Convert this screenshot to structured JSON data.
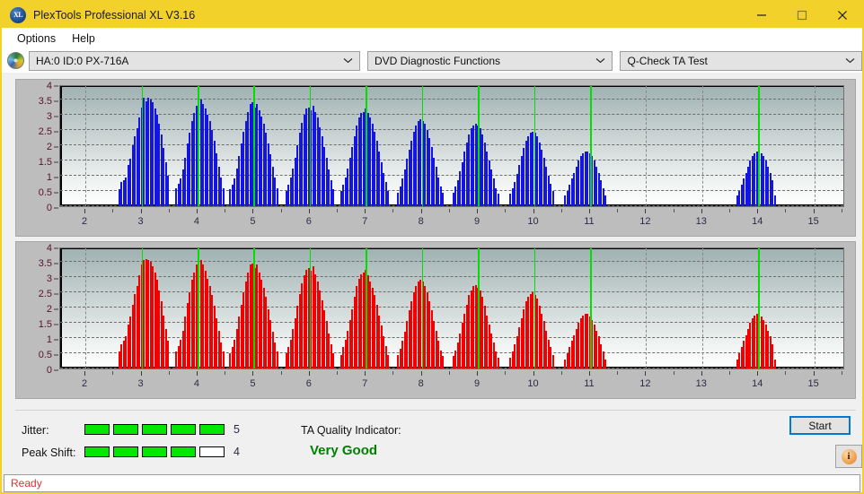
{
  "window": {
    "title": "PlexTools Professional XL V3.16",
    "icon": "XL",
    "minimize": "minimize-icon",
    "maximize": "maximize-icon",
    "close": "close-icon",
    "titlebar_color": "#f2d22a"
  },
  "menu": {
    "items": [
      {
        "label": "Options"
      },
      {
        "label": "Help"
      }
    ]
  },
  "toolbar": {
    "drive": {
      "value": "HA:0 ID:0  PX-716A"
    },
    "function": {
      "value": "DVD Diagnostic Functions"
    },
    "test": {
      "value": "Q-Check TA Test"
    }
  },
  "chart_data": [
    {
      "type": "bar",
      "title": "",
      "name": "jitter-chart",
      "series_color": "#1515e0",
      "xlabel": "",
      "ylabel": "",
      "xlim": [
        1.55,
        15.55
      ],
      "ylim": [
        0,
        4
      ],
      "xticks": [
        2,
        3,
        4,
        5,
        6,
        7,
        8,
        9,
        10,
        11,
        12,
        13,
        14,
        15
      ],
      "yticks": [
        0,
        0.5,
        1,
        1.5,
        2,
        2.5,
        3,
        3.5,
        4
      ],
      "ytick_labels": [
        "0",
        "0.5",
        "1",
        "1.5",
        "2",
        "2.5",
        "3",
        "3.5",
        "4"
      ],
      "grid": true,
      "markers_x": [
        3,
        4,
        5,
        6,
        7,
        8,
        9,
        10,
        11,
        14
      ],
      "marker_color": "#00e000",
      "x": [
        2.6,
        2.64,
        2.68,
        2.72,
        2.76,
        2.8,
        2.84,
        2.88,
        2.92,
        2.96,
        3.0,
        3.04,
        3.08,
        3.12,
        3.16,
        3.2,
        3.24,
        3.28,
        3.32,
        3.36,
        3.4,
        3.44,
        3.48,
        3.62,
        3.66,
        3.7,
        3.74,
        3.78,
        3.82,
        3.86,
        3.9,
        3.94,
        3.98,
        4.02,
        4.06,
        4.1,
        4.14,
        4.18,
        4.22,
        4.26,
        4.3,
        4.34,
        4.38,
        4.42,
        4.46,
        4.58,
        4.62,
        4.66,
        4.7,
        4.74,
        4.78,
        4.82,
        4.86,
        4.9,
        4.94,
        4.98,
        5.02,
        5.06,
        5.1,
        5.14,
        5.18,
        5.22,
        5.26,
        5.3,
        5.34,
        5.38,
        5.42,
        5.58,
        5.62,
        5.66,
        5.7,
        5.74,
        5.78,
        5.82,
        5.86,
        5.9,
        5.94,
        5.98,
        6.02,
        6.06,
        6.1,
        6.14,
        6.18,
        6.22,
        6.26,
        6.3,
        6.34,
        6.38,
        6.42,
        6.56,
        6.6,
        6.64,
        6.68,
        6.72,
        6.76,
        6.8,
        6.84,
        6.88,
        6.92,
        6.96,
        7.0,
        7.04,
        7.08,
        7.12,
        7.16,
        7.2,
        7.24,
        7.28,
        7.32,
        7.36,
        7.4,
        7.58,
        7.62,
        7.66,
        7.7,
        7.74,
        7.78,
        7.82,
        7.86,
        7.9,
        7.94,
        7.98,
        8.02,
        8.06,
        8.1,
        8.14,
        8.18,
        8.22,
        8.26,
        8.3,
        8.34,
        8.38,
        8.56,
        8.6,
        8.64,
        8.68,
        8.72,
        8.76,
        8.8,
        8.84,
        8.88,
        8.92,
        8.96,
        9.0,
        9.04,
        9.08,
        9.12,
        9.16,
        9.2,
        9.24,
        9.28,
        9.32,
        9.36,
        9.58,
        9.62,
        9.66,
        9.7,
        9.74,
        9.78,
        9.82,
        9.86,
        9.9,
        9.94,
        9.98,
        10.02,
        10.06,
        10.1,
        10.14,
        10.18,
        10.22,
        10.26,
        10.3,
        10.34,
        10.56,
        10.6,
        10.64,
        10.68,
        10.72,
        10.76,
        10.8,
        10.84,
        10.88,
        10.92,
        10.96,
        11.0,
        11.04,
        11.08,
        11.12,
        11.16,
        11.2,
        11.24,
        11.28,
        13.62,
        13.66,
        13.7,
        13.74,
        13.78,
        13.82,
        13.86,
        13.9,
        13.94,
        13.98,
        14.02,
        14.06,
        14.1,
        14.14,
        14.18,
        14.22,
        14.26,
        14.3
      ],
      "values": [
        0.55,
        0.8,
        0.85,
        0.95,
        1.35,
        1.55,
        2.0,
        2.3,
        2.55,
        2.9,
        3.25,
        3.55,
        3.45,
        3.55,
        3.5,
        3.4,
        3.2,
        3.0,
        2.7,
        2.35,
        1.9,
        1.45,
        1.0,
        0.6,
        0.75,
        0.9,
        1.2,
        1.6,
        2.05,
        2.4,
        2.8,
        3.05,
        3.3,
        3.55,
        3.5,
        3.35,
        3.2,
        3.0,
        2.8,
        2.5,
        2.15,
        1.75,
        1.3,
        0.95,
        0.6,
        0.55,
        0.7,
        0.9,
        1.25,
        1.65,
        2.05,
        2.45,
        2.8,
        3.1,
        3.35,
        3.4,
        3.25,
        3.35,
        3.15,
        2.95,
        2.7,
        2.4,
        2.05,
        1.7,
        1.3,
        0.95,
        0.6,
        0.5,
        0.7,
        0.95,
        1.25,
        1.6,
        2.0,
        2.4,
        2.75,
        3.0,
        3.2,
        3.25,
        3.15,
        3.3,
        3.1,
        2.9,
        2.6,
        2.3,
        1.95,
        1.6,
        1.2,
        0.85,
        0.55,
        0.5,
        0.7,
        0.95,
        1.25,
        1.6,
        1.95,
        2.3,
        2.65,
        2.9,
        3.05,
        3.1,
        3.2,
        3.05,
        2.9,
        2.7,
        2.45,
        2.15,
        1.8,
        1.45,
        1.1,
        0.8,
        0.5,
        0.45,
        0.65,
        0.9,
        1.2,
        1.55,
        1.85,
        2.15,
        2.45,
        2.65,
        2.8,
        2.85,
        2.8,
        2.7,
        2.5,
        2.25,
        1.95,
        1.6,
        1.3,
        0.95,
        0.65,
        0.45,
        0.45,
        0.65,
        0.85,
        1.15,
        1.45,
        1.8,
        2.1,
        2.35,
        2.55,
        2.65,
        2.7,
        2.65,
        2.55,
        2.35,
        2.1,
        1.8,
        1.5,
        1.2,
        0.9,
        0.6,
        0.4,
        0.4,
        0.6,
        0.8,
        1.05,
        1.35,
        1.65,
        1.9,
        2.15,
        2.3,
        2.4,
        2.45,
        2.4,
        2.3,
        2.1,
        1.85,
        1.6,
        1.3,
        1.0,
        0.75,
        0.5,
        0.35,
        0.5,
        0.7,
        0.9,
        1.1,
        1.3,
        1.5,
        1.65,
        1.75,
        1.8,
        1.8,
        1.75,
        1.65,
        1.5,
        1.3,
        1.1,
        0.85,
        0.6,
        0.35,
        0.35,
        0.5,
        0.7,
        0.9,
        1.1,
        1.3,
        1.5,
        1.65,
        1.75,
        1.8,
        1.8,
        1.75,
        1.65,
        1.5,
        1.3,
        1.1,
        0.85,
        0.35
      ]
    },
    {
      "type": "bar",
      "title": "",
      "name": "peak-shift-chart",
      "series_color": "#f00000",
      "xlabel": "",
      "ylabel": "",
      "xlim": [
        1.55,
        15.55
      ],
      "ylim": [
        0,
        4
      ],
      "xticks": [
        2,
        3,
        4,
        5,
        6,
        7,
        8,
        9,
        10,
        11,
        12,
        13,
        14,
        15
      ],
      "yticks": [
        0,
        0.5,
        1,
        1.5,
        2,
        2.5,
        3,
        3.5,
        4
      ],
      "ytick_labels": [
        "0",
        "0.5",
        "1",
        "1.5",
        "2",
        "2.5",
        "3",
        "3.5",
        "4"
      ],
      "grid": true,
      "markers_x": [
        3,
        4,
        5,
        6,
        7,
        8,
        9,
        10,
        11,
        14
      ],
      "marker_color": "#00e000",
      "x": [
        2.6,
        2.64,
        2.68,
        2.72,
        2.76,
        2.8,
        2.84,
        2.88,
        2.92,
        2.96,
        3.0,
        3.04,
        3.08,
        3.12,
        3.16,
        3.2,
        3.24,
        3.28,
        3.32,
        3.36,
        3.4,
        3.44,
        3.48,
        3.62,
        3.66,
        3.7,
        3.74,
        3.78,
        3.82,
        3.86,
        3.9,
        3.94,
        3.98,
        4.02,
        4.06,
        4.1,
        4.14,
        4.18,
        4.22,
        4.26,
        4.3,
        4.34,
        4.38,
        4.42,
        4.46,
        4.58,
        4.62,
        4.66,
        4.7,
        4.74,
        4.78,
        4.82,
        4.86,
        4.9,
        4.94,
        4.98,
        5.02,
        5.06,
        5.1,
        5.14,
        5.18,
        5.22,
        5.26,
        5.3,
        5.34,
        5.38,
        5.42,
        5.58,
        5.62,
        5.66,
        5.7,
        5.74,
        5.78,
        5.82,
        5.86,
        5.9,
        5.94,
        5.98,
        6.02,
        6.06,
        6.1,
        6.14,
        6.18,
        6.22,
        6.26,
        6.3,
        6.34,
        6.38,
        6.42,
        6.56,
        6.6,
        6.64,
        6.68,
        6.72,
        6.76,
        6.8,
        6.84,
        6.88,
        6.92,
        6.96,
        7.0,
        7.04,
        7.08,
        7.12,
        7.16,
        7.2,
        7.24,
        7.28,
        7.32,
        7.36,
        7.4,
        7.58,
        7.62,
        7.66,
        7.7,
        7.74,
        7.78,
        7.82,
        7.86,
        7.9,
        7.94,
        7.98,
        8.02,
        8.06,
        8.1,
        8.14,
        8.18,
        8.22,
        8.26,
        8.3,
        8.34,
        8.38,
        8.56,
        8.6,
        8.64,
        8.68,
        8.72,
        8.76,
        8.8,
        8.84,
        8.88,
        8.92,
        8.96,
        9.0,
        9.04,
        9.08,
        9.12,
        9.16,
        9.2,
        9.24,
        9.28,
        9.32,
        9.36,
        9.58,
        9.62,
        9.66,
        9.7,
        9.74,
        9.78,
        9.82,
        9.86,
        9.9,
        9.94,
        9.98,
        10.02,
        10.06,
        10.1,
        10.14,
        10.18,
        10.22,
        10.26,
        10.3,
        10.34,
        10.56,
        10.6,
        10.64,
        10.68,
        10.72,
        10.76,
        10.8,
        10.84,
        10.88,
        10.92,
        10.96,
        11.0,
        11.04,
        11.08,
        11.12,
        11.16,
        11.2,
        11.24,
        11.28,
        13.62,
        13.66,
        13.7,
        13.74,
        13.78,
        13.82,
        13.86,
        13.9,
        13.94,
        13.98,
        14.02,
        14.06,
        14.1,
        14.14,
        14.18,
        14.22,
        14.26,
        14.3
      ],
      "values": [
        0.55,
        0.8,
        0.9,
        1.05,
        1.45,
        1.7,
        2.1,
        2.45,
        2.7,
        3.05,
        3.4,
        3.55,
        3.6,
        3.55,
        3.5,
        3.35,
        3.15,
        2.9,
        2.55,
        2.2,
        1.75,
        1.3,
        0.9,
        0.55,
        0.75,
        0.95,
        1.25,
        1.7,
        2.15,
        2.5,
        2.9,
        3.15,
        3.4,
        3.6,
        3.55,
        3.4,
        3.2,
        2.95,
        2.7,
        2.4,
        2.05,
        1.65,
        1.25,
        0.85,
        0.55,
        0.5,
        0.7,
        0.95,
        1.3,
        1.7,
        2.1,
        2.5,
        2.85,
        3.15,
        3.4,
        3.45,
        3.3,
        3.4,
        3.15,
        2.9,
        2.65,
        2.35,
        1.95,
        1.6,
        1.2,
        0.85,
        0.55,
        0.5,
        0.7,
        0.95,
        1.3,
        1.65,
        2.05,
        2.45,
        2.8,
        3.05,
        3.25,
        3.3,
        3.2,
        3.35,
        3.1,
        2.85,
        2.55,
        2.25,
        1.9,
        1.55,
        1.15,
        0.8,
        0.5,
        0.45,
        0.7,
        0.95,
        1.25,
        1.6,
        1.95,
        2.35,
        2.7,
        2.95,
        3.1,
        3.15,
        3.25,
        3.05,
        2.85,
        2.65,
        2.4,
        2.1,
        1.75,
        1.4,
        1.05,
        0.75,
        0.45,
        0.45,
        0.65,
        0.9,
        1.2,
        1.55,
        1.9,
        2.2,
        2.5,
        2.7,
        2.85,
        2.9,
        2.85,
        2.7,
        2.5,
        2.2,
        1.9,
        1.55,
        1.25,
        0.9,
        0.6,
        0.4,
        0.4,
        0.6,
        0.85,
        1.15,
        1.5,
        1.8,
        2.1,
        2.4,
        2.55,
        2.7,
        2.75,
        2.65,
        2.55,
        2.35,
        2.05,
        1.75,
        1.45,
        1.15,
        0.85,
        0.55,
        0.35,
        0.35,
        0.55,
        0.8,
        1.05,
        1.35,
        1.65,
        1.95,
        2.2,
        2.35,
        2.45,
        2.5,
        2.4,
        2.3,
        2.05,
        1.8,
        1.55,
        1.25,
        0.95,
        0.7,
        0.45,
        0.3,
        0.5,
        0.7,
        0.9,
        1.1,
        1.3,
        1.5,
        1.65,
        1.75,
        1.8,
        1.8,
        1.7,
        1.6,
        1.45,
        1.25,
        1.05,
        0.8,
        0.55,
        0.3,
        0.3,
        0.5,
        0.7,
        0.9,
        1.1,
        1.3,
        1.5,
        1.65,
        1.75,
        1.8,
        1.8,
        1.7,
        1.6,
        1.45,
        1.25,
        1.05,
        0.8,
        0.3
      ]
    }
  ],
  "results": {
    "jitter_label": "Jitter:",
    "jitter_value": "5",
    "jitter_filled": 5,
    "jitter_total": 5,
    "peak_shift_label": "Peak Shift:",
    "peak_shift_value": "4",
    "peak_shift_filled": 4,
    "peak_shift_total": 5,
    "ta_quality_label": "TA Quality Indicator:",
    "ta_quality_value": "Very Good",
    "ta_quality_color": "#008000",
    "meter_on_color": "#00e800"
  },
  "actions": {
    "start_label": "Start",
    "info_glyph": "i"
  },
  "status": {
    "text": "Ready",
    "color": "#e03030"
  }
}
